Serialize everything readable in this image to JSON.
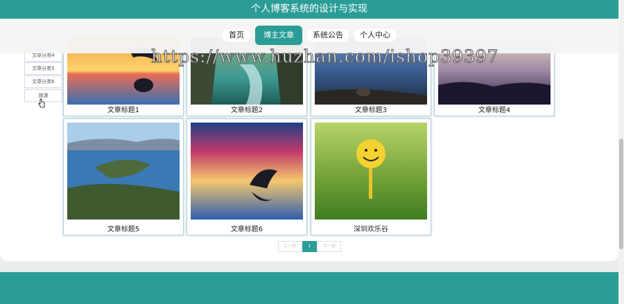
{
  "header": {
    "title": "个人博客系统的设计与实现"
  },
  "nav": {
    "items": [
      "首页",
      "博主文章",
      "系统公告",
      "个人中心"
    ],
    "active": "博主文章"
  },
  "watermark": "https://www.huzhan.com/ishop39397",
  "sidebar": {
    "items": [
      "文章分类4",
      "文章分类5",
      "文章分类6",
      "旅游"
    ]
  },
  "articles": [
    {
      "title": "文章标题1",
      "image": "sunset-dolphin"
    },
    {
      "title": "文章标题2",
      "image": "river-valley"
    },
    {
      "title": "文章标题3",
      "image": "lakeshore-dusk"
    },
    {
      "title": "文章标题4",
      "image": "grass-sunset"
    },
    {
      "title": "文章标题5",
      "image": "lake-island"
    },
    {
      "title": "文章标题6",
      "image": "dolphin-sunset"
    },
    {
      "title": "深圳欢乐谷",
      "image": "smiley-golfball"
    }
  ],
  "pagination": {
    "prev": "上一页",
    "current": "1",
    "next": "下一页"
  },
  "colors": {
    "brand": "#2a9d96"
  }
}
